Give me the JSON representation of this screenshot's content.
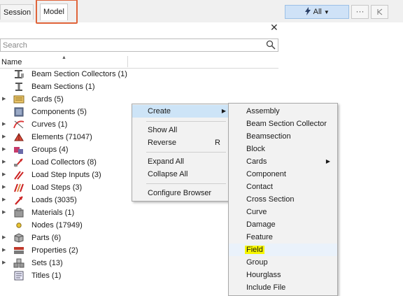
{
  "tabs": {
    "session": "Session",
    "model": "Model"
  },
  "toolbar": {
    "all_label": "All",
    "dots_label": "···"
  },
  "search": {
    "placeholder": "Search"
  },
  "columns": {
    "name": "Name"
  },
  "tree": [
    {
      "label": "Beam Section Collectors  (1)",
      "icon": "beam-section-collector-icon",
      "expandable": false
    },
    {
      "label": "Beam Sections  (1)",
      "icon": "beam-section-icon",
      "expandable": false
    },
    {
      "label": "Cards  (5)",
      "icon": "cards-icon",
      "expandable": true
    },
    {
      "label": "Components  (5)",
      "icon": "components-icon",
      "expandable": false
    },
    {
      "label": "Curves  (1)",
      "icon": "curves-icon",
      "expandable": true
    },
    {
      "label": "Elements  (71047)",
      "icon": "elements-icon",
      "expandable": true
    },
    {
      "label": "Groups  (4)",
      "icon": "groups-icon",
      "expandable": true
    },
    {
      "label": "Load Collectors  (8)",
      "icon": "load-collectors-icon",
      "expandable": true
    },
    {
      "label": "Load Step Inputs  (3)",
      "icon": "load-step-inputs-icon",
      "expandable": true
    },
    {
      "label": "Load Steps  (3)",
      "icon": "load-steps-icon",
      "expandable": true
    },
    {
      "label": "Loads  (3035)",
      "icon": "loads-icon",
      "expandable": true
    },
    {
      "label": "Materials  (1)",
      "icon": "materials-icon",
      "expandable": true
    },
    {
      "label": "Nodes  (17949)",
      "icon": "nodes-icon",
      "expandable": false
    },
    {
      "label": "Parts  (6)",
      "icon": "parts-icon",
      "expandable": true
    },
    {
      "label": "Properties  (2)",
      "icon": "properties-icon",
      "expandable": true
    },
    {
      "label": "Sets  (13)",
      "icon": "sets-icon",
      "expandable": true
    },
    {
      "label": "Titles  (1)",
      "icon": "titles-icon",
      "expandable": false
    }
  ],
  "context_menu": {
    "create": "Create",
    "show_all": "Show All",
    "reverse": "Reverse",
    "reverse_shortcut": "R",
    "expand_all": "Expand All",
    "collapse_all": "Collapse All",
    "configure_browser": "Configure Browser"
  },
  "create_submenu": [
    "Assembly",
    "Beam Section Collector",
    "Beamsection",
    "Block",
    "Cards",
    "Component",
    "Contact",
    "Cross Section",
    "Curve",
    "Damage",
    "Feature",
    "Field",
    "Group",
    "Hourglass",
    "Include File"
  ],
  "colors": {
    "accent": "#cde4f7",
    "highlight": "#f6f600",
    "tab_outline": "#e0643a"
  }
}
